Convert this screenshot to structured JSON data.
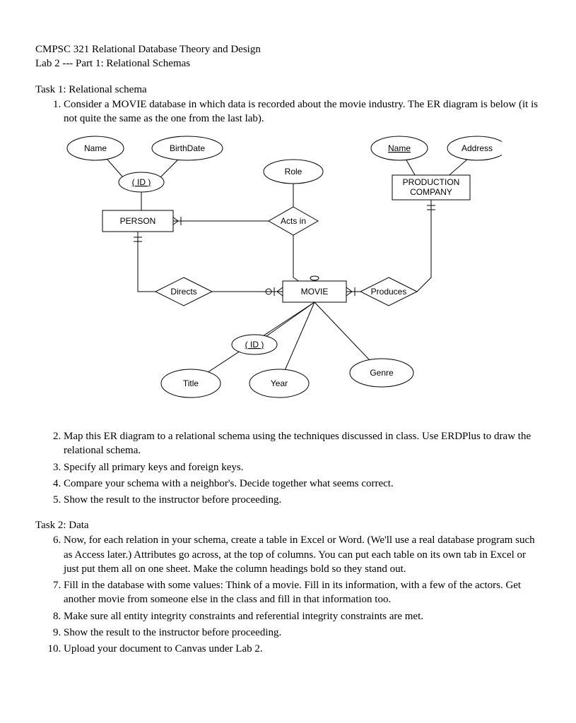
{
  "header": {
    "course": "CMPSC 321 Relational Database Theory and Design",
    "lab": "Lab 2 --- Part 1: Relational Schemas"
  },
  "task1": {
    "title": "Task 1: Relational schema",
    "items": [
      "Consider a MOVIE database in which data is recorded about the movie industry. The ER diagram is below (it is not quite the same as the one from the last lab).",
      "Map this ER diagram to a relational schema using the techniques discussed in class. Use ERDPlus to draw the relational schema.",
      "Specify all primary keys and foreign keys.",
      "Compare your schema with a neighbor's. Decide together what seems correct.",
      "Show the result to the instructor before proceeding."
    ]
  },
  "task2": {
    "title": "Task 2: Data",
    "items": [
      "Now, for each relation in your schema, create a table in Excel or Word. (We'll use a real database program such as Access later.) Attributes go across, at the top of columns. You can put each table on its own tab in Excel or just put them all on one sheet. Make the column headings bold so they stand out.",
      "Fill in the database with some values: Think of a movie. Fill in its information, with a few of the actors. Get another movie from someone else in the class and fill in that information too.",
      "Make sure all entity integrity constraints and referential integrity constraints are met.",
      "Show the result to the instructor before proceeding.",
      "Upload your document to Canvas under Lab 2."
    ]
  },
  "diagram": {
    "entities": {
      "person": "PERSON",
      "movie": "MOVIE",
      "prodco_1": "PRODUCTION",
      "prodco_2": "COMPANY"
    },
    "relationships": {
      "acts_in": "Acts in",
      "directs": "Directs",
      "produces": "Produces"
    },
    "attributes": {
      "person_name": "Name",
      "person_birthdate": "BirthDate",
      "person_id": "( ID )",
      "role": "Role",
      "prodco_name": "Name",
      "prodco_address": "Address",
      "movie_id": "( ID )",
      "movie_title": "Title",
      "movie_year": "Year",
      "movie_genre": "Genre"
    }
  }
}
